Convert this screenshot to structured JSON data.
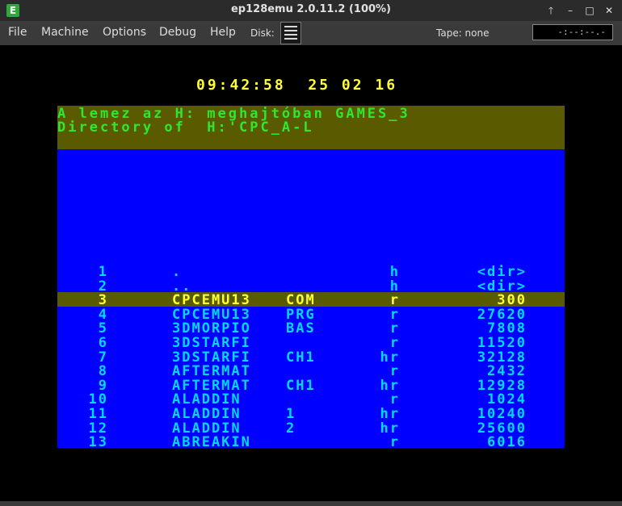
{
  "window": {
    "title": "ep128emu 2.0.11.2 (100%)",
    "app_icon": "E",
    "buttons": {
      "up": "🡑",
      "minimize": "–",
      "maximize": "□",
      "close": "✕"
    }
  },
  "menu": {
    "items": [
      "File",
      "Machine",
      "Options",
      "Debug",
      "Help"
    ],
    "disk_label": "Disk:",
    "tape_label": "Tape: none",
    "tape_counter": "-:--:--.-"
  },
  "screen": {
    "clock": "09:42:58  25 02 16",
    "header_line1": "A lemez az H: meghajtóban GAMES_3",
    "header_line2": "Directory of  H:'CPC_A-L",
    "rows": [
      {
        "num": "1",
        "name": ".",
        "ext": "",
        "attr": "h",
        "size": "<dir>"
      },
      {
        "num": "2",
        "name": "..",
        "ext": "",
        "attr": "h",
        "size": "<dir>"
      },
      {
        "num": "3",
        "name": "CPCEMU13",
        "ext": "COM",
        "attr": "r",
        "size": "300"
      },
      {
        "num": "4",
        "name": "CPCEMU13",
        "ext": "PRG",
        "attr": "r",
        "size": "27620"
      },
      {
        "num": "5",
        "name": "3DMORPIO",
        "ext": "BAS",
        "attr": "r",
        "size": "7808"
      },
      {
        "num": "6",
        "name": "3DSTARFI",
        "ext": "",
        "attr": "r",
        "size": "11520"
      },
      {
        "num": "7",
        "name": "3DSTARFI",
        "ext": "CH1",
        "attr": "hr",
        "size": "32128"
      },
      {
        "num": "8",
        "name": "AFTERMAT",
        "ext": "",
        "attr": "r",
        "size": "2432"
      },
      {
        "num": "9",
        "name": "AFTERMAT",
        "ext": "CH1",
        "attr": "hr",
        "size": "12928"
      },
      {
        "num": "10",
        "name": "ALADDIN",
        "ext": "",
        "attr": "r",
        "size": "1024"
      },
      {
        "num": "11",
        "name": "ALADDIN",
        "ext": "1",
        "attr": "hr",
        "size": "10240"
      },
      {
        "num": "12",
        "name": "ALADDIN",
        "ext": "2",
        "attr": "hr",
        "size": "25600"
      },
      {
        "num": "13",
        "name": "ABREAKIN",
        "ext": "",
        "attr": "r",
        "size": "6016"
      }
    ]
  }
}
